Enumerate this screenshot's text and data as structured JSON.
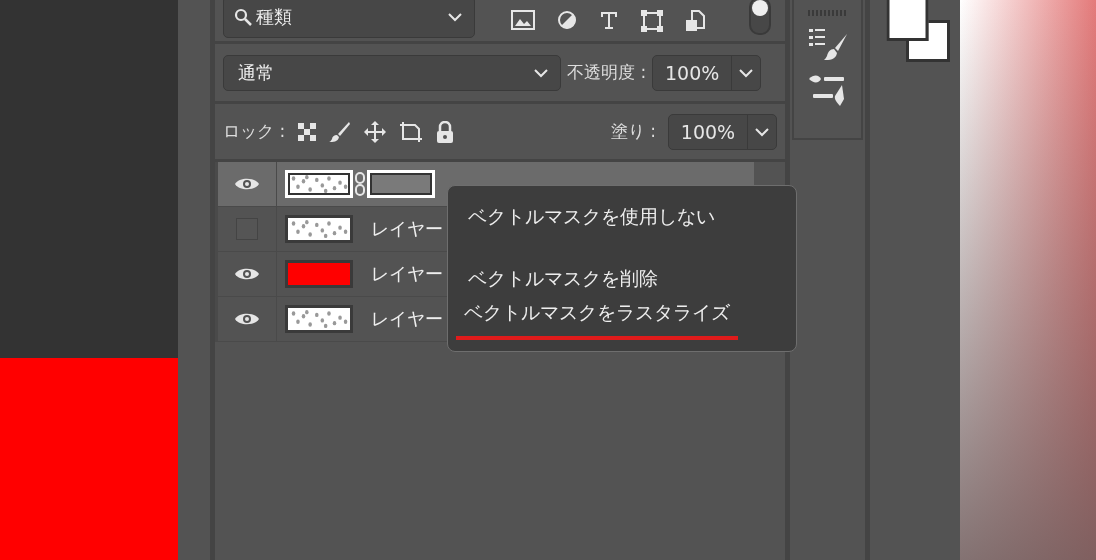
{
  "filter": {
    "value": "種類",
    "toggle_on": true
  },
  "blend": {
    "mode": "通常",
    "opacity_label": "不透明度 :",
    "opacity": "100%"
  },
  "lock": {
    "label": "ロック :",
    "fill_label": "塗り :",
    "fill": "100%"
  },
  "layers": [
    {
      "visible": true,
      "selected": true,
      "kind": "texture",
      "mask": true
    },
    {
      "visible": false,
      "selected": false,
      "kind": "texture",
      "name": "レイヤー"
    },
    {
      "visible": true,
      "selected": false,
      "kind": "solid",
      "color": "#ff0000",
      "name": "レイヤー"
    },
    {
      "visible": true,
      "selected": false,
      "kind": "texture",
      "name": "レイヤー"
    }
  ],
  "context_menu": [
    {
      "kind": "item",
      "label": "ベクトルマスクを使用しない",
      "underlined": false
    },
    {
      "kind": "separator"
    },
    {
      "kind": "item",
      "label": "ベクトルマスクを削除",
      "underlined": false
    },
    {
      "kind": "item",
      "label": "ベクトルマスクをラスタライズ",
      "underlined": true
    }
  ]
}
